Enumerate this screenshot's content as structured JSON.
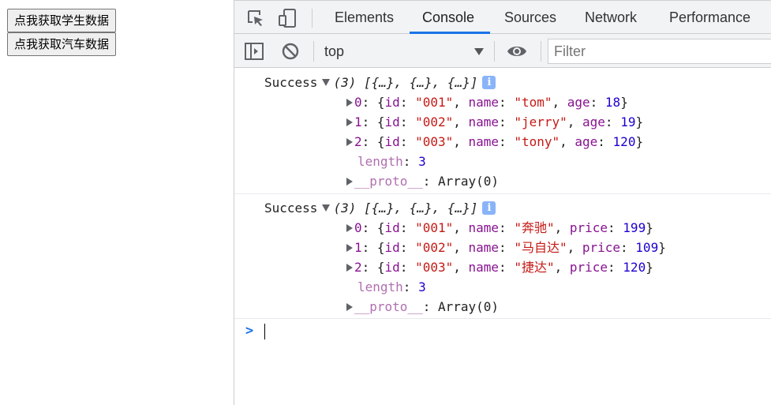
{
  "page": {
    "button1_label": "点我获取学生数据",
    "button2_label": "点我获取汽车数据"
  },
  "devtools": {
    "tabs": [
      "Elements",
      "Console",
      "Sources",
      "Network",
      "Performance"
    ],
    "active_tab": "Console",
    "context": "top",
    "filter_placeholder": "Filter",
    "accent_color": "#1a73e8"
  },
  "console": {
    "messages": [
      {
        "prefix": "Success",
        "summary": "(3) [{…}, {…}, {…}]",
        "items": [
          {
            "index": "0",
            "id": "\"001\"",
            "name": "\"tom\"",
            "field": "age",
            "value": "18"
          },
          {
            "index": "1",
            "id": "\"002\"",
            "name": "\"jerry\"",
            "field": "age",
            "value": "19"
          },
          {
            "index": "2",
            "id": "\"003\"",
            "name": "\"tony\"",
            "field": "age",
            "value": "120"
          }
        ],
        "length_label": "length",
        "length_value": "3",
        "proto_label": "__proto__",
        "proto_value": "Array(0)"
      },
      {
        "prefix": "Success",
        "summary": "(3) [{…}, {…}, {…}]",
        "items": [
          {
            "index": "0",
            "id": "\"001\"",
            "name": "\"奔驰\"",
            "field": "price",
            "value": "199"
          },
          {
            "index": "1",
            "id": "\"002\"",
            "name": "\"马自达\"",
            "field": "price",
            "value": "109"
          },
          {
            "index": "2",
            "id": "\"003\"",
            "name": "\"捷达\"",
            "field": "price",
            "value": "120"
          }
        ],
        "length_label": "length",
        "length_value": "3",
        "proto_label": "__proto__",
        "proto_value": "Array(0)"
      }
    ],
    "prompt_symbol": ">"
  }
}
